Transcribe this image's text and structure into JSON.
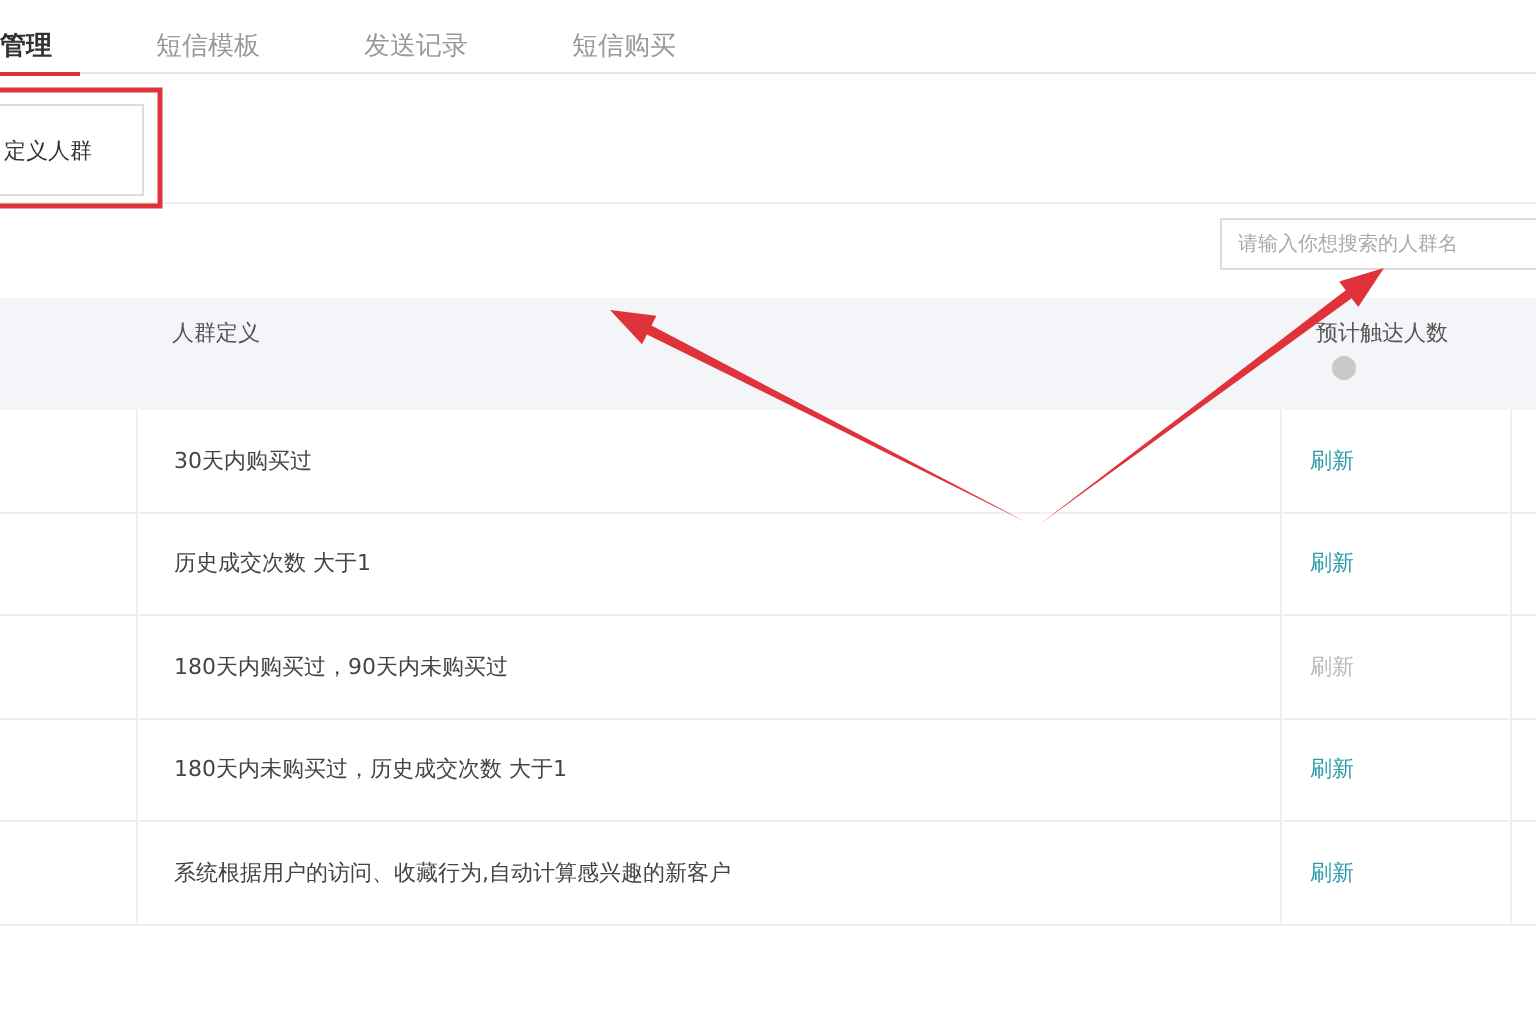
{
  "tabs": [
    {
      "label": "管理",
      "selected": true
    },
    {
      "label": "短信模板",
      "selected": false
    },
    {
      "label": "发送记录",
      "selected": false
    },
    {
      "label": "短信购买",
      "selected": false
    }
  ],
  "tool_button": {
    "label": "定义人群"
  },
  "search": {
    "placeholder": "请输入你想搜索的人群名"
  },
  "table": {
    "columns": [
      "人群定义",
      "预计触达人数"
    ],
    "rows": [
      {
        "definition": "30天内购买过",
        "action": "刷新",
        "disabled": false
      },
      {
        "definition": "历史成交次数 大于1",
        "action": "刷新",
        "disabled": false
      },
      {
        "definition": "180天内购买过，90天内未购买过",
        "action": "刷新",
        "disabled": true
      },
      {
        "definition": "180天内未购买过，历史成交次数 大于1",
        "action": "刷新",
        "disabled": false
      },
      {
        "definition": "系统根据用户的访问、收藏行为,自动计算感兴趣的新客户",
        "action": "刷新",
        "disabled": false
      }
    ]
  },
  "annotations": [
    {
      "kind": "box",
      "color": "#e0323a"
    },
    {
      "kind": "arrow",
      "color": "#e0323a"
    },
    {
      "kind": "arrow",
      "color": "#e0323a"
    }
  ]
}
